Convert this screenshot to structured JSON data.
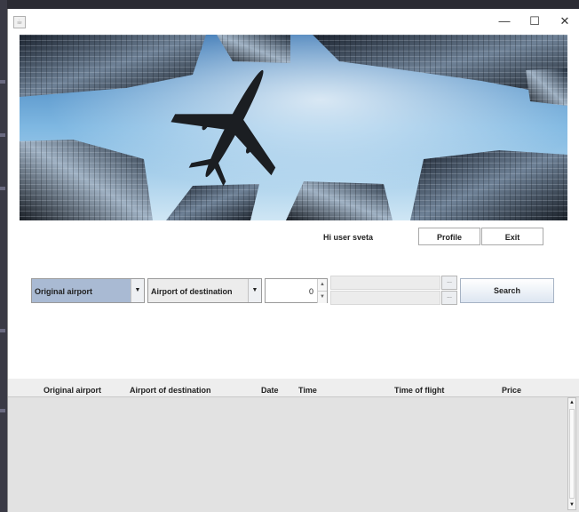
{
  "window": {
    "controls": {
      "minimize": "—",
      "maximize": "☐",
      "close": "✕"
    }
  },
  "header": {
    "greeting": "Hi user sveta",
    "profile_label": "Profile",
    "exit_label": "Exit"
  },
  "search": {
    "origin_value": "Original airport",
    "destination_value": "Airport of destination",
    "passengers_value": "0",
    "date_button_label": "...",
    "search_label": "Search"
  },
  "table": {
    "columns": [
      "Original airport",
      "Airport of destination",
      "Date",
      "Time",
      "Time of flight",
      "Price"
    ],
    "rows": []
  },
  "colors": {
    "selected_combo": "#a9bad3",
    "table_background": "#e2e2e2"
  }
}
